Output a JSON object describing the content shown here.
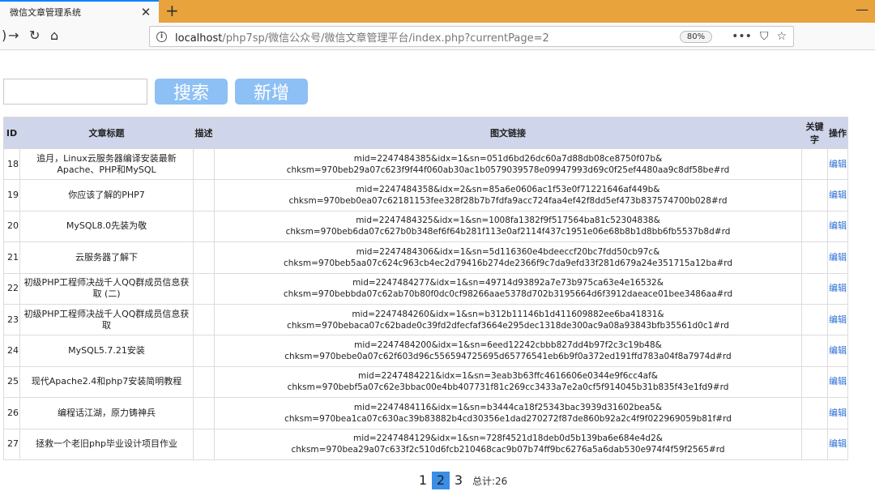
{
  "browser": {
    "tab_title": "微信文章管理系统",
    "url_host": "localhost",
    "url_path": "/php7sp/微信公众号/微信文章管理平台/index.php?currentPage=2",
    "zoom": "80%"
  },
  "toolbar": {
    "search_label": "搜索",
    "add_label": "新增",
    "search_value": ""
  },
  "table": {
    "headers": {
      "id": "ID",
      "title": "文章标题",
      "desc": "描述",
      "link": "图文链接",
      "keyword": "关键字",
      "op": "操作"
    },
    "op_label": "编辑",
    "rows": [
      {
        "id": "18",
        "title": "追月，Linux云服务器编译安装最新Apache、PHP和MySQL",
        "desc": "",
        "link1": "mid=2247484385&idx=1&sn=051d6bd26dc60a7d88db08ce8750f07b&",
        "link2": "chksm=970beb29a07c623f9f44f060ab30ac1b0579039578e09947993d69c0f25ef4480aa9c8df58be#rd",
        "keyword": ""
      },
      {
        "id": "19",
        "title": "你应该了解的PHP7",
        "desc": "",
        "link1": "mid=2247484358&idx=2&sn=85a6e0606ac1f53e0f71221646af449b&",
        "link2": "chksm=970beb0ea07c62181153fee328f28b7b7fdfa9acc724faa4ef42f8dd5ef473b837574700b028#rd",
        "keyword": ""
      },
      {
        "id": "20",
        "title": "MySQL8.0先装为敬",
        "desc": "",
        "link1": "mid=2247484325&idx=1&sn=1008fa1382f9f517564ba81c52304838&",
        "link2": "chksm=970beb6da07c627b0b348ef6f64b281f113e0af2114f437c1951e06e68b8b1d8bb6fb5537b8d#rd",
        "keyword": ""
      },
      {
        "id": "21",
        "title": "云服务器了解下",
        "desc": "",
        "link1": "mid=2247484306&idx=1&sn=5d116360e4bdeeccf20bc7fdd50cb97c&",
        "link2": "chksm=970beb5aa07c624c963cb4ec2d79416b274de2366f9c7da9efd33f281d679a24e351715a12ba#rd",
        "keyword": ""
      },
      {
        "id": "22",
        "title": "初级PHP工程师决战千人QQ群成员信息获取 (二)",
        "desc": "",
        "link1": "mid=2247484277&idx=1&sn=49714d93892a7e73b975ca63e4e16532&",
        "link2": "chksm=970bebbda07c62ab70b80f0dc0cf98266aae5378d702b3195664d6f3912daeace01bee3486aa#rd",
        "keyword": ""
      },
      {
        "id": "23",
        "title": "初级PHP工程师决战千人QQ群成员信息获取",
        "desc": "",
        "link1": "mid=2247484260&idx=1&sn=b312b11146b1d411609882ee6ba41831&",
        "link2": "chksm=970bebaca07c62bade0c39fd2dfecfaf3664e295dec1318de300ac9a08a93843bfb35561d0c1#rd",
        "keyword": ""
      },
      {
        "id": "24",
        "title": "MySQL5.7.21安装",
        "desc": "",
        "link1": "mid=2247484200&idx=1&sn=6eed12242cbbb827dd4b97f2c3c19b48&",
        "link2": "chksm=970bebe0a07c62f603d96c556594725695d65776541eb6b9f0a372ed191ffd783a04f8a7974d#rd",
        "keyword": ""
      },
      {
        "id": "25",
        "title": "现代Apache2.4和php7安装简明教程",
        "desc": "",
        "link1": "mid=2247484221&idx=1&sn=3eab3b63ffc4616606e0344e9f6cc4af&",
        "link2": "chksm=970bebf5a07c62e3bbac00e4bb407731f81c269cc3433a7e2a0cf5f914045b31b835f43e1fd9#rd",
        "keyword": ""
      },
      {
        "id": "26",
        "title": "编程话江湖，原力铸神兵",
        "desc": "",
        "link1": "mid=2247484116&idx=1&sn=b3444ca18f25343bac3939d31602bea5&",
        "link2": "chksm=970bea1ca07c630ac39b83882b4cd30356e1dad270272f87de860b92a2c4f9f022969059b81f#rd",
        "keyword": ""
      },
      {
        "id": "27",
        "title": "拯救一个老旧php毕业设计项目作业",
        "desc": "",
        "link1": "mid=2247484129&idx=1&sn=728f4521d18deb0d5b139ba6e684e4d2&",
        "link2": "chksm=970bea29a07c633f2c510d6fcb210468cac9b07b74ff9bc6276a5a6dab530e974f4f59f2565#rd",
        "keyword": ""
      }
    ]
  },
  "pagination": {
    "pages": [
      "1",
      "2",
      "3"
    ],
    "current": "2",
    "total": "总计:26"
  }
}
